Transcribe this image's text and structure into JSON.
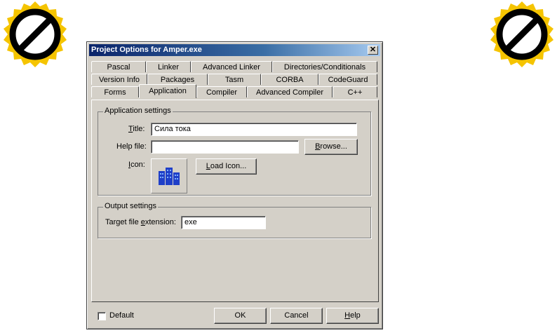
{
  "dialog": {
    "title": "Project Options for Amper.exe",
    "close_glyph": "✕"
  },
  "tabs": {
    "row1": [
      "Pascal",
      "Linker",
      "Advanced Linker",
      "Directories/Conditionals"
    ],
    "row2": [
      "Version Info",
      "Packages",
      "Tasm",
      "CORBA",
      "CodeGuard"
    ],
    "row3": [
      "Forms",
      "Application",
      "Compiler",
      "Advanced Compiler",
      "C++"
    ],
    "active": "Application"
  },
  "application_settings": {
    "legend": "Application settings",
    "title_label": "Title:",
    "title_value": "Сила тока",
    "help_file_label": "Help file:",
    "help_file_value": "",
    "browse_label": "Browse...",
    "icon_label": "Icon:",
    "load_icon_label": "Load Icon..."
  },
  "output_settings": {
    "legend": "Output settings",
    "extension_label": "Target file extension:",
    "extension_value": "exe"
  },
  "footer": {
    "default_label": "Default",
    "default_checked": false,
    "ok_label": "OK",
    "cancel_label": "Cancel",
    "help_label": "Help"
  },
  "colors": {
    "dialog_bg": "#d4d0c8",
    "titlebar_start": "#0a246a",
    "badge_yellow": "#f5c400"
  }
}
